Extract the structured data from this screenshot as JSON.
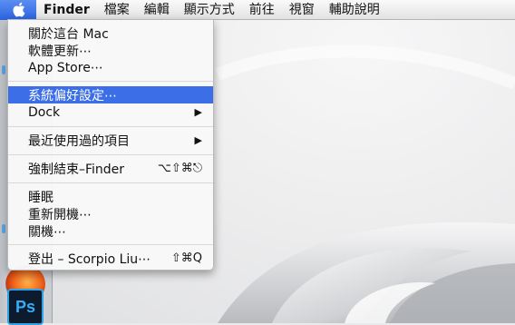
{
  "menubar": {
    "apple_icon": "apple-logo",
    "app_name": "Finder",
    "items": [
      "檔案",
      "編輯",
      "顯示方式",
      "前往",
      "視窗",
      "輔助說明"
    ]
  },
  "apple_menu": {
    "about": "關於這台 Mac",
    "software_update": "軟體更新⋯",
    "app_store": "App Store⋯",
    "system_prefs": "系統偏好設定⋯",
    "dock": "Dock",
    "recent_items": "最近使用過的項目",
    "force_quit": "強制結束–Finder",
    "force_quit_shortcut": "⌥⇧⌘⎋",
    "sleep": "睡眠",
    "restart": "重新開機⋯",
    "shutdown": "關機⋯",
    "logout": "登出 – Scorpio Liu⋯",
    "logout_shortcut": "⇧⌘Q",
    "submenu_arrow": "▶"
  },
  "dock": {
    "ps_label": "Ps"
  },
  "colors": {
    "highlight": "#3c6ee8",
    "ps_blue": "#35aef7"
  }
}
